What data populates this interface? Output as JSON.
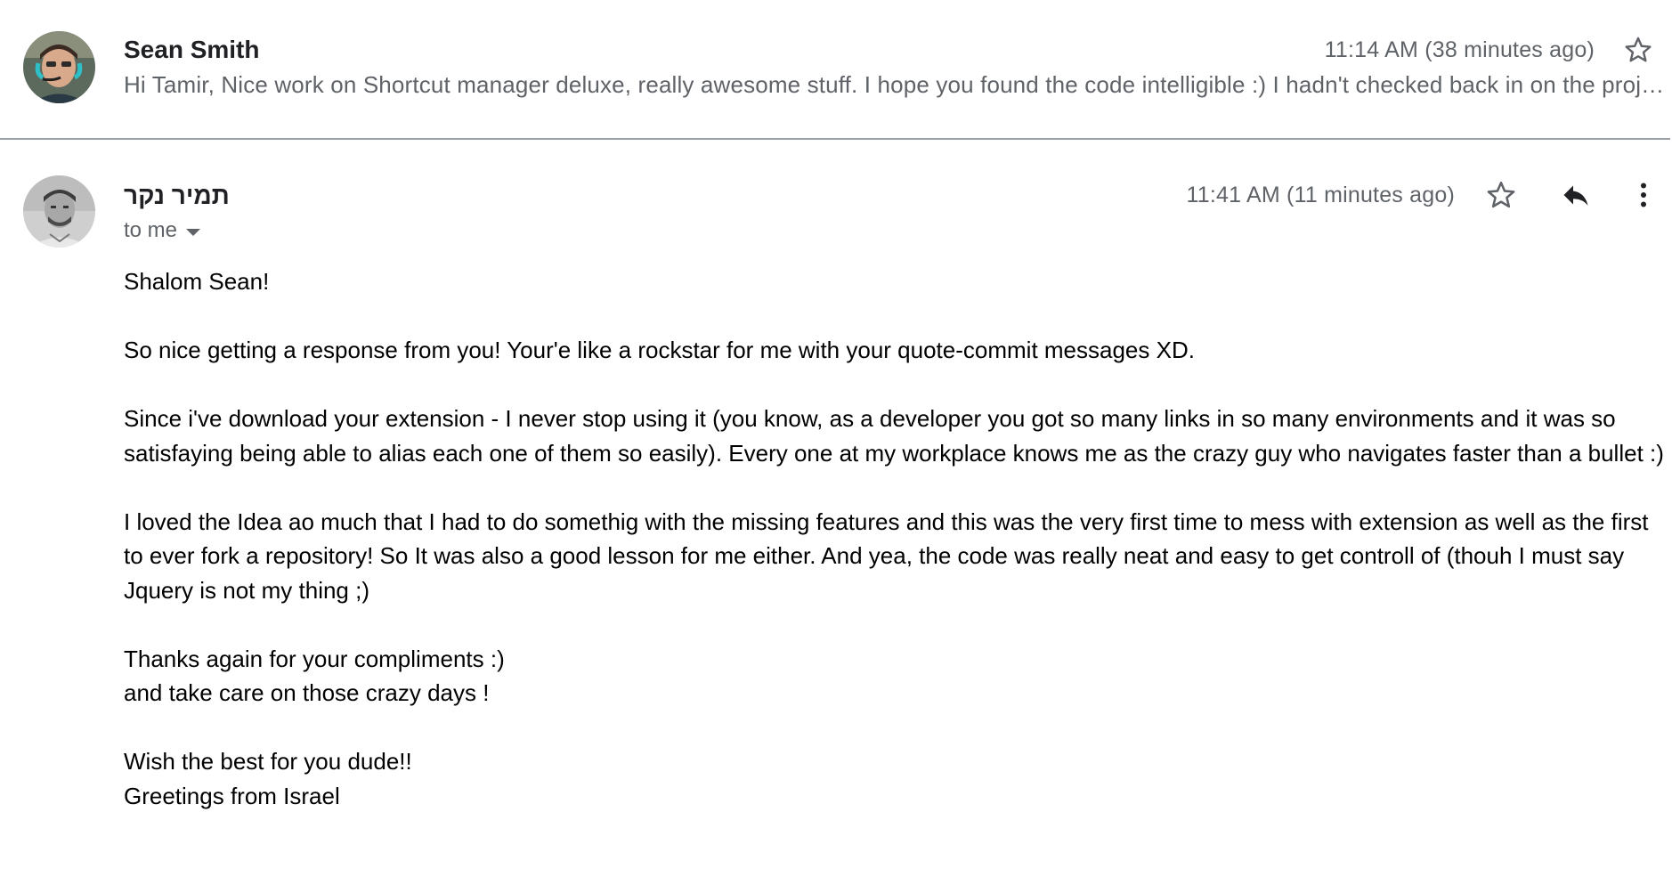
{
  "messages": [
    {
      "sender": "Sean Smith",
      "timestamp": "11:14 AM (38 minutes ago)",
      "snippet": "Hi Tamir, Nice work on Shortcut manager deluxe, really awesome stuff. I hope you found the code intelligible :) I hadn't checked back in on the project in a while and was surprised to see so many updates.",
      "starred": false
    },
    {
      "sender": "תמיר נקר",
      "recipient": "to me",
      "timestamp": "11:41 AM (11 minutes ago)",
      "starred": false,
      "body": [
        "Shalom Sean!",
        "So nice getting a response from you! Your'e like a rockstar for me with your quote-commit messages XD.",
        "Since i've download your extension - I never stop using it (you know, as a developer you got so many links in so many environments and it was so satisfaying being able to alias each one of them so easily). Every one at my workplace knows me as the crazy guy who navigates faster than a bullet :)",
        "I loved the Idea ao much that I had to do somethig with the missing features and this was the very first time to mess with extension as well as the first to ever fork a repository! So It was also a good lesson for me either. And yea, the code was really neat and easy to get controll of (thouh I must say Jquery is not my thing ;)",
        "Thanks again for your compliments :)\nand take care on those crazy days !",
        "Wish the best for you dude!!\nGreetings from Israel"
      ]
    }
  ],
  "icons": {
    "star": "star-outline-icon",
    "reply": "reply-arrow-icon",
    "more": "more-vertical-icon",
    "caret": "caret-down-icon"
  },
  "colors": {
    "primary_text": "#202124",
    "secondary_text": "#5f6368",
    "body_text": "#000000",
    "divider": "#9aa0a6"
  }
}
